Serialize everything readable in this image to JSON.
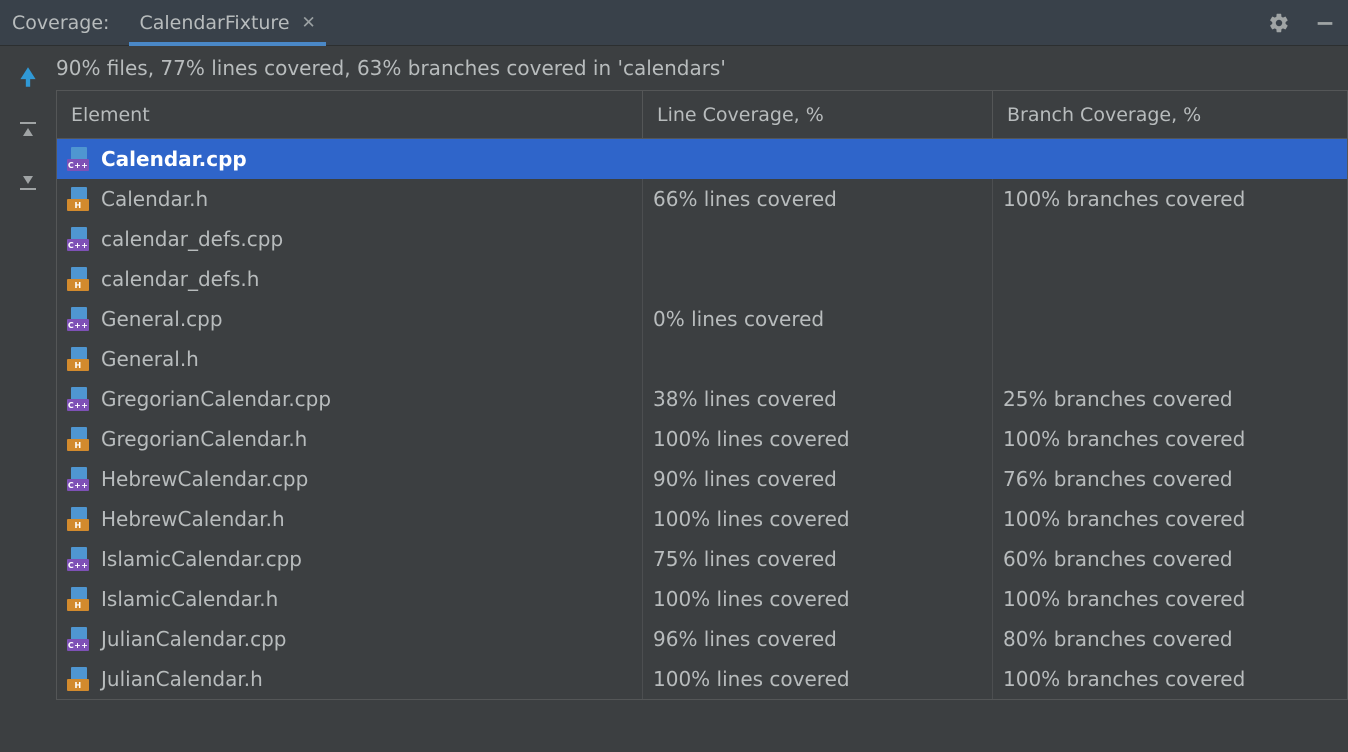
{
  "header": {
    "title": "Coverage:",
    "tab": "CalendarFixture"
  },
  "summary": "90% files, 77% lines covered, 63% branches covered in 'calendars'",
  "columns": {
    "element": "Element",
    "line": "Line Coverage, %",
    "branch": "Branch Coverage, %"
  },
  "icon_labels": {
    "cpp": "C++",
    "h": "H"
  },
  "rows": [
    {
      "type": "cpp",
      "name": "Calendar.cpp",
      "line": "",
      "branch": "",
      "selected": true
    },
    {
      "type": "h",
      "name": "Calendar.h",
      "line": "66% lines covered",
      "branch": "100% branches covered",
      "selected": false
    },
    {
      "type": "cpp",
      "name": "calendar_defs.cpp",
      "line": "",
      "branch": "",
      "selected": false
    },
    {
      "type": "h",
      "name": "calendar_defs.h",
      "line": "",
      "branch": "",
      "selected": false
    },
    {
      "type": "cpp",
      "name": "General.cpp",
      "line": "0% lines covered",
      "branch": "",
      "selected": false
    },
    {
      "type": "h",
      "name": "General.h",
      "line": "",
      "branch": "",
      "selected": false
    },
    {
      "type": "cpp",
      "name": "GregorianCalendar.cpp",
      "line": "38% lines covered",
      "branch": "25% branches covered",
      "selected": false
    },
    {
      "type": "h",
      "name": "GregorianCalendar.h",
      "line": "100% lines covered",
      "branch": "100% branches covered",
      "selected": false
    },
    {
      "type": "cpp",
      "name": "HebrewCalendar.cpp",
      "line": "90% lines covered",
      "branch": "76% branches covered",
      "selected": false
    },
    {
      "type": "h",
      "name": "HebrewCalendar.h",
      "line": "100% lines covered",
      "branch": "100% branches covered",
      "selected": false
    },
    {
      "type": "cpp",
      "name": "IslamicCalendar.cpp",
      "line": "75% lines covered",
      "branch": "60% branches covered",
      "selected": false
    },
    {
      "type": "h",
      "name": "IslamicCalendar.h",
      "line": "100% lines covered",
      "branch": "100% branches covered",
      "selected": false
    },
    {
      "type": "cpp",
      "name": "JulianCalendar.cpp",
      "line": "96% lines covered",
      "branch": "80% branches covered",
      "selected": false
    },
    {
      "type": "h",
      "name": "JulianCalendar.h",
      "line": "100% lines covered",
      "branch": "100% branches covered",
      "selected": false
    }
  ]
}
